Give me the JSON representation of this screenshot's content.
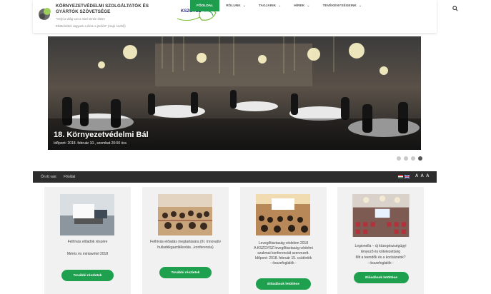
{
  "header": {
    "org_title": "KÖRNYEZETVÉDELMI SZOLGÁLTATÓK ÉS GYÁRTÓK SZÖVETSÉGE",
    "slogan_line1": "\"Helyi a világ van a mieé terein életre",
    "slogan_line2": "Elköteleztek vagyunk a élete a jövőért\" (Hajó Ándról)",
    "partner_logo": "KSZGYSZ"
  },
  "nav": {
    "items": [
      {
        "label": "FŐOLDAL",
        "active": true
      },
      {
        "label": "RÓLUNK",
        "active": false
      },
      {
        "label": "TAGJAINK",
        "active": false
      },
      {
        "label": "HÍREK",
        "active": false
      },
      {
        "label": "TEVÉKENYSÉGEINK",
        "active": false
      }
    ]
  },
  "hero": {
    "title": "18. Környezetvédelmi Bál",
    "subtitle": "Időpont: 2018. február 10., szombat 20:00 óra",
    "slide_count": 4,
    "active_slide": 4
  },
  "breadcrumb": {
    "label": "Ön itt van:",
    "home": "Főoldal",
    "font_controls": "A A A"
  },
  "cards": [
    {
      "line1": "Felhívás előadók részére",
      "line2": "Mérés és mintavétel 2018",
      "line3": "",
      "line4": "",
      "button": "További részletek"
    },
    {
      "line1": "Felhívás előadás megtartására (III. Innovatív",
      "line2": "hulladékgazdálkodás...konferencia)",
      "line3": "",
      "line4": "",
      "button": "További részletek"
    },
    {
      "line1": "Levegőtisztaság-védelem 2018",
      "line2": "A KSZGYSZ levegőtisztaság-védelmi",
      "line3": "szakmai konferenciát szervezett.",
      "line4": "Időpont: 2018. február 15. csütörtök",
      "line5": "- összefoglalók -",
      "button": "Előadások letöltése"
    },
    {
      "line1": "Legionella – új közegészségügyi",
      "line2": "tényező és kötelezettség",
      "line3": "Mit a teendők és a kockázatok?",
      "line4": "- összefoglalók -",
      "button": "Előadások letöltése"
    }
  ],
  "colors": {
    "brand_green": "#1f9d4e",
    "dark_bar": "#2d2d2d",
    "card_bg": "#f1f1f1"
  }
}
